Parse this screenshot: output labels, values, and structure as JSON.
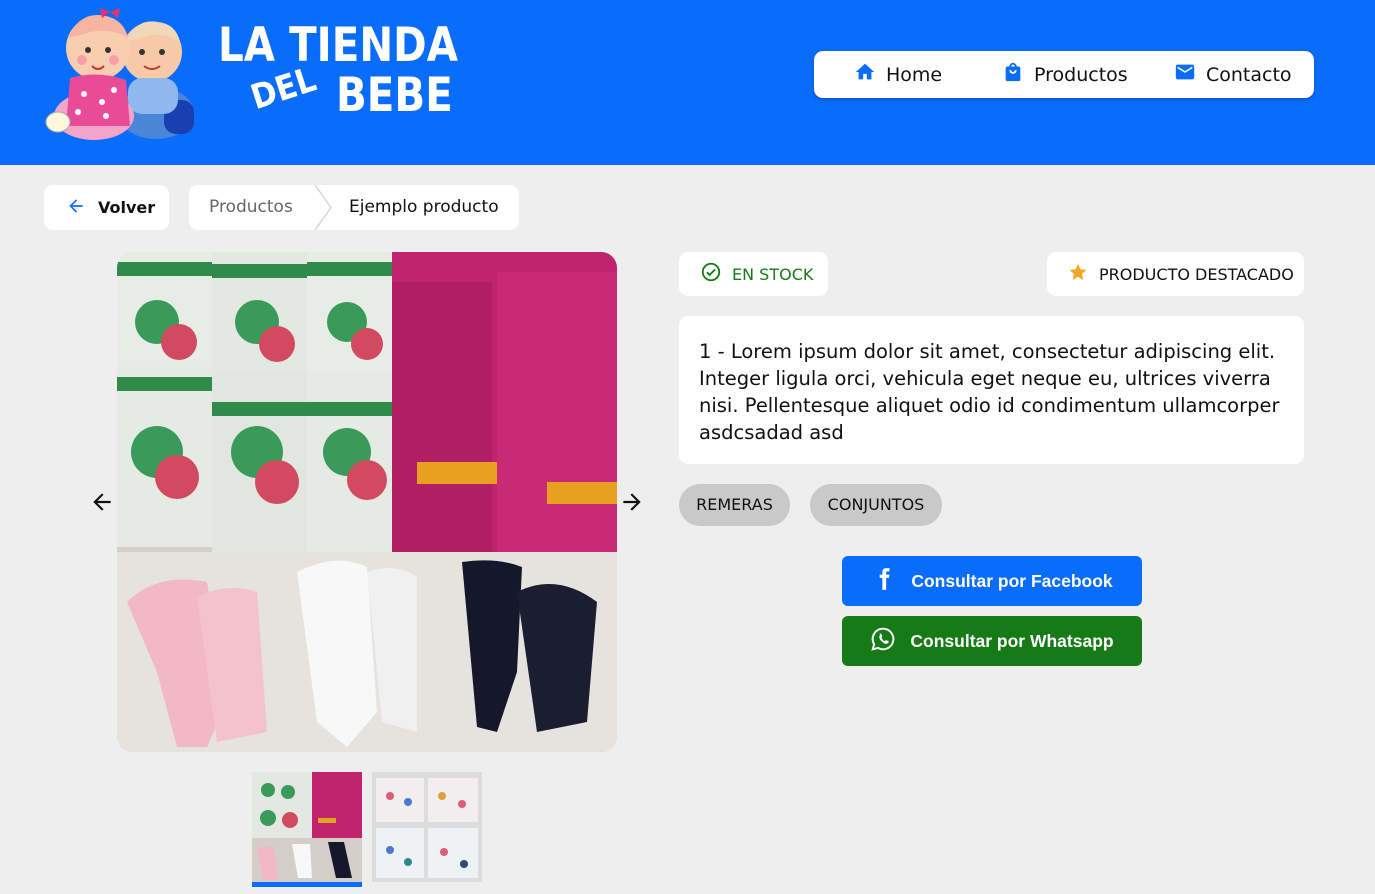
{
  "header": {
    "logo": {
      "line1": "LA TIENDA",
      "line2_small": "DEL",
      "line2_big": "BEBE"
    },
    "nav": [
      {
        "label": "Home",
        "icon": "home-icon"
      },
      {
        "label": "Productos",
        "icon": "shopping-bag-icon"
      },
      {
        "label": "Contacto",
        "icon": "mail-icon"
      }
    ]
  },
  "breadcrumb": {
    "back_label": "Volver",
    "items": [
      "Productos",
      "Ejemplo producto"
    ]
  },
  "product": {
    "stock_label": "EN STOCK",
    "featured_label": "PRODUCTO DESTACADO",
    "description": "1 - Lorem ipsum dolor sit amet, consectetur adipiscing elit. Integer ligula orci, vehicula eget neque eu, ultrices viverra nisi. Pellentesque aliquet odio id condimentum ullamcorper asdcsadad asd",
    "tags": [
      "REMERAS",
      "CONJUNTOS"
    ],
    "facebook_cta": "Consultar por Facebook",
    "whatsapp_cta": "Consultar por Whatsapp",
    "image_count": 2,
    "selected_image": 1
  },
  "colors": {
    "brand_blue": "#0a6cfb",
    "whatsapp_green": "#167a17",
    "stock_green": "#1a7a1a",
    "star_orange": "#f5a524"
  }
}
